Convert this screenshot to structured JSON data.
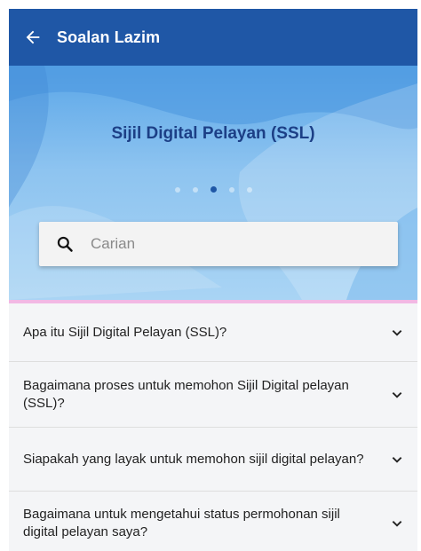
{
  "appbar": {
    "title": "Soalan Lazim",
    "back_icon": "arrow-left-icon"
  },
  "hero": {
    "title": "Sijil Digital Pelayan (SSL)",
    "slides_total": 5,
    "active_slide": 3
  },
  "search": {
    "placeholder": "Carian",
    "value": "",
    "icon": "search-icon"
  },
  "faq": {
    "items": [
      {
        "question": "Apa itu Sijil Digital Pelayan (SSL)?"
      },
      {
        "question": "Bagaimana proses untuk memohon Sijil Digital pelayan (SSL)?"
      },
      {
        "question": "Siapakah yang layak untuk memohon sijil digital pelayan?"
      },
      {
        "question": "Bagaimana untuk mengetahui status permohonan sijil digital pelayan saya?"
      }
    ]
  },
  "colors": {
    "primary": "#1f57a6",
    "hero_title": "#1c3f86",
    "accent": "#f2b8e4"
  }
}
